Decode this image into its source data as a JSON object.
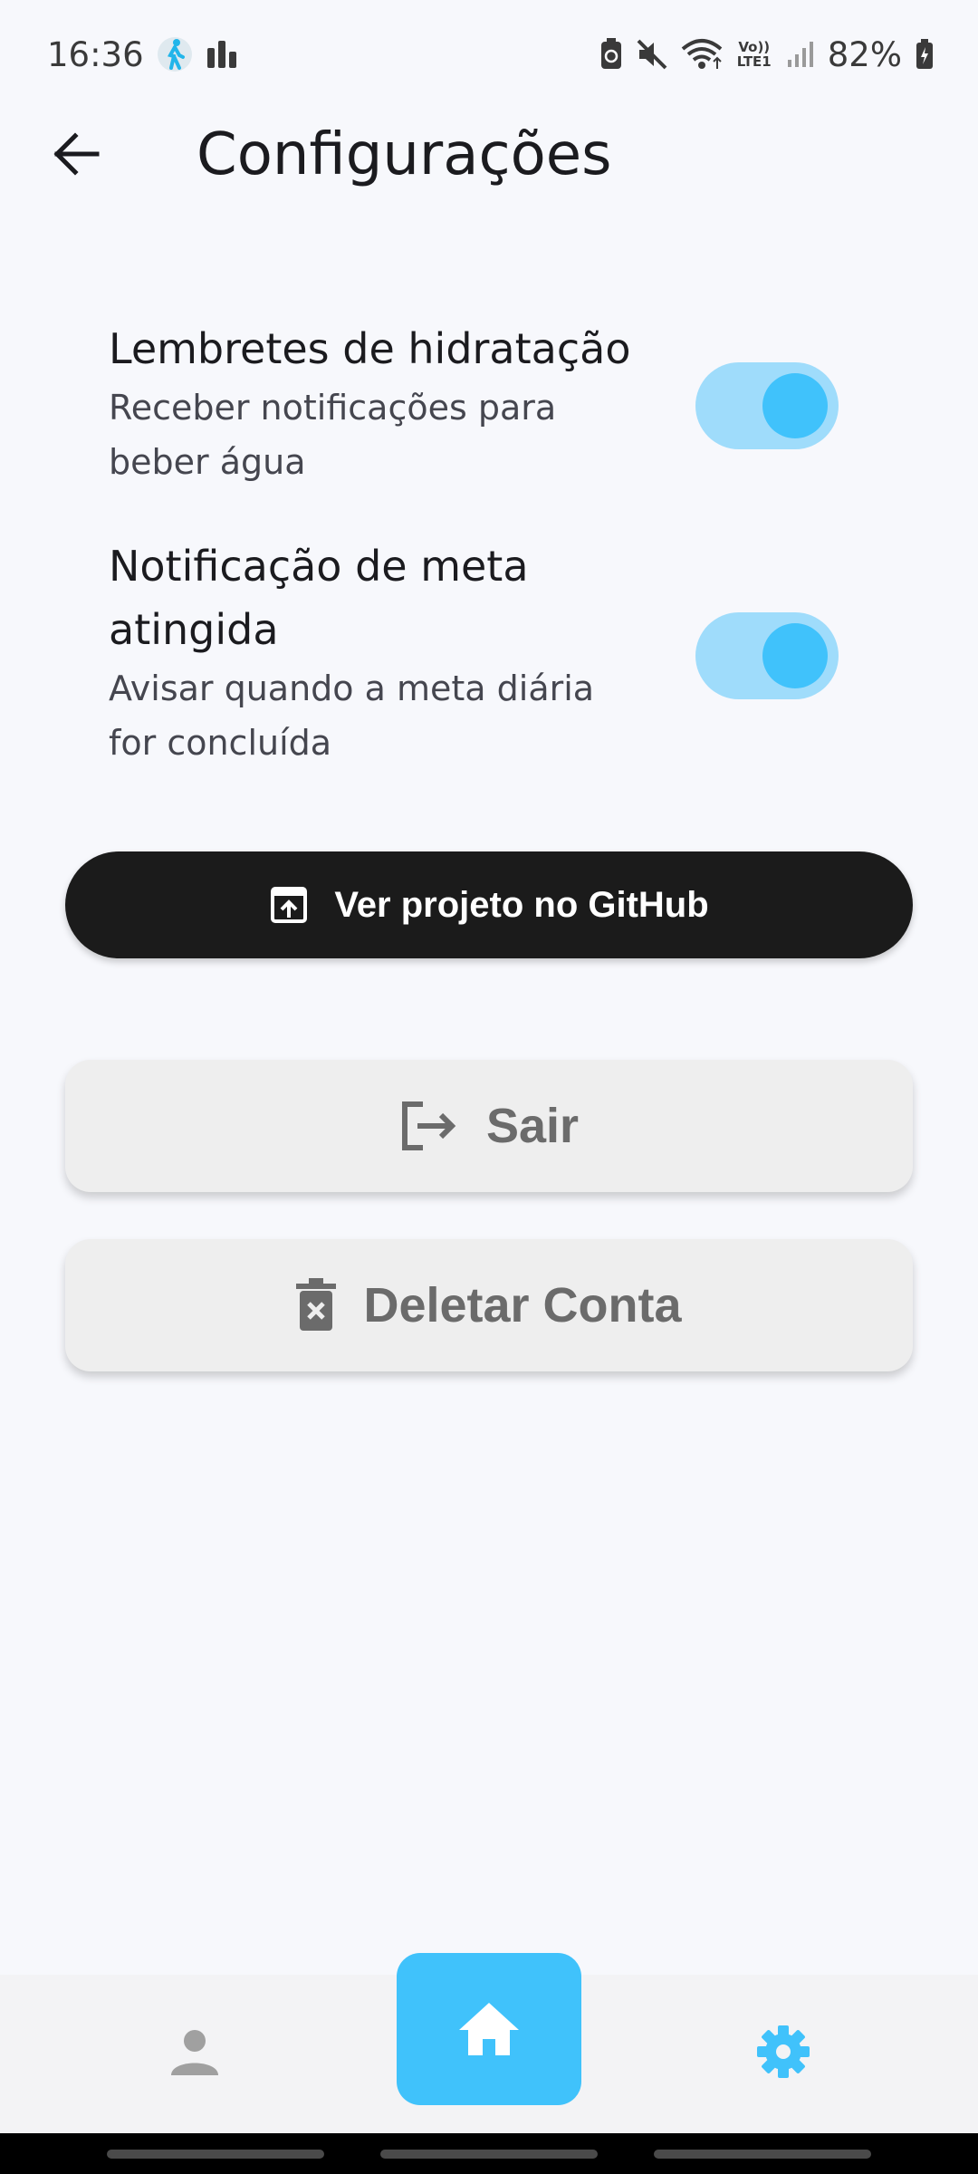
{
  "status_bar": {
    "time": "16:36",
    "battery": "82%",
    "left_icons": [
      "walking-person-icon",
      "bar-chart-icon"
    ],
    "right_icons": [
      "battery-saver-icon",
      "mute-icon",
      "wifi-icon",
      "volte-icon",
      "signal-icon",
      "battery-icon"
    ],
    "volte_label": "Vo)) LTE1"
  },
  "app_bar": {
    "title": "Configurações",
    "back_icon": "arrow-back-icon"
  },
  "settings": {
    "hydration": {
      "title": "Lembretes de hidratação",
      "subtitle": "Receber notificações para beber água",
      "enabled": true
    },
    "goal": {
      "title": "Notificação de meta atingida",
      "subtitle": "Avisar quando a meta diária for concluída",
      "enabled": true
    }
  },
  "buttons": {
    "github": {
      "label": "Ver projeto no GitHub",
      "icon": "open-in-new-icon"
    },
    "logout": {
      "label": "Sair",
      "icon": "logout-icon"
    },
    "delete": {
      "label": "Deletar Conta",
      "icon": "delete-icon"
    }
  },
  "bottom_nav": {
    "items": [
      {
        "name": "profile",
        "icon": "person-icon",
        "active": false
      },
      {
        "name": "home",
        "icon": "home-icon",
        "active": true
      },
      {
        "name": "settings",
        "icon": "gear-icon",
        "active": true
      }
    ]
  },
  "colors": {
    "accent": "#40c2fb",
    "toggle_track": "#9fdcfb",
    "background": "#f7f8fc",
    "dark_button": "#1b1b1b",
    "light_button": "#eeeeee",
    "inactive_icon": "#a0a0a0"
  }
}
